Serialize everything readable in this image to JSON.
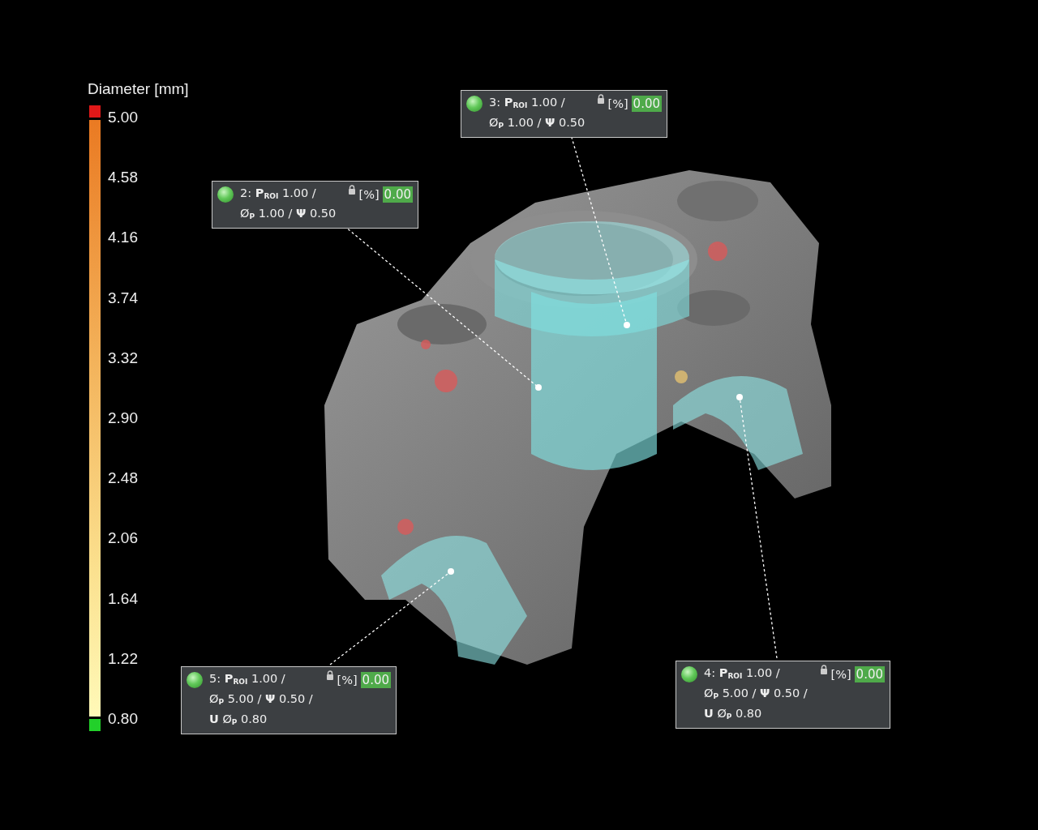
{
  "legend": {
    "title": "Diameter [mm]",
    "ticks": [
      "5.00",
      "4.58",
      "4.16",
      "3.74",
      "3.32",
      "2.90",
      "2.48",
      "2.06",
      "1.64",
      "1.22",
      "0.80"
    ]
  },
  "annotations": [
    {
      "lines": [
        "2: **P**$_{ROI}$ 1.00 /",
        "Ø$_{P}$ 1.00 / **Ψ** 0.50"
      ],
      "unit": "[%]",
      "value": "0.00"
    },
    {
      "lines": [
        "3: **P**$_{ROI}$ 1.00 /",
        "Ø$_{P}$ 1.00 / **Ψ** 0.50"
      ],
      "unit": "[%]",
      "value": "0.00"
    },
    {
      "lines": [
        "5: **P**$_{ROI}$ 1.00 /",
        "Ø$_{P}$ 5.00 / **Ψ** 0.50 /",
        "**U** Ø$_{P}$ 0.80"
      ],
      "unit": "[%]",
      "value": "0.00"
    },
    {
      "lines": [
        "4: **P**$_{ROI}$ 1.00 /",
        "Ø$_{P}$ 5.00 / **Ψ** 0.50 /",
        "**U** Ø$_{P}$ 0.80"
      ],
      "unit": "[%]",
      "value": "0.00"
    }
  ]
}
